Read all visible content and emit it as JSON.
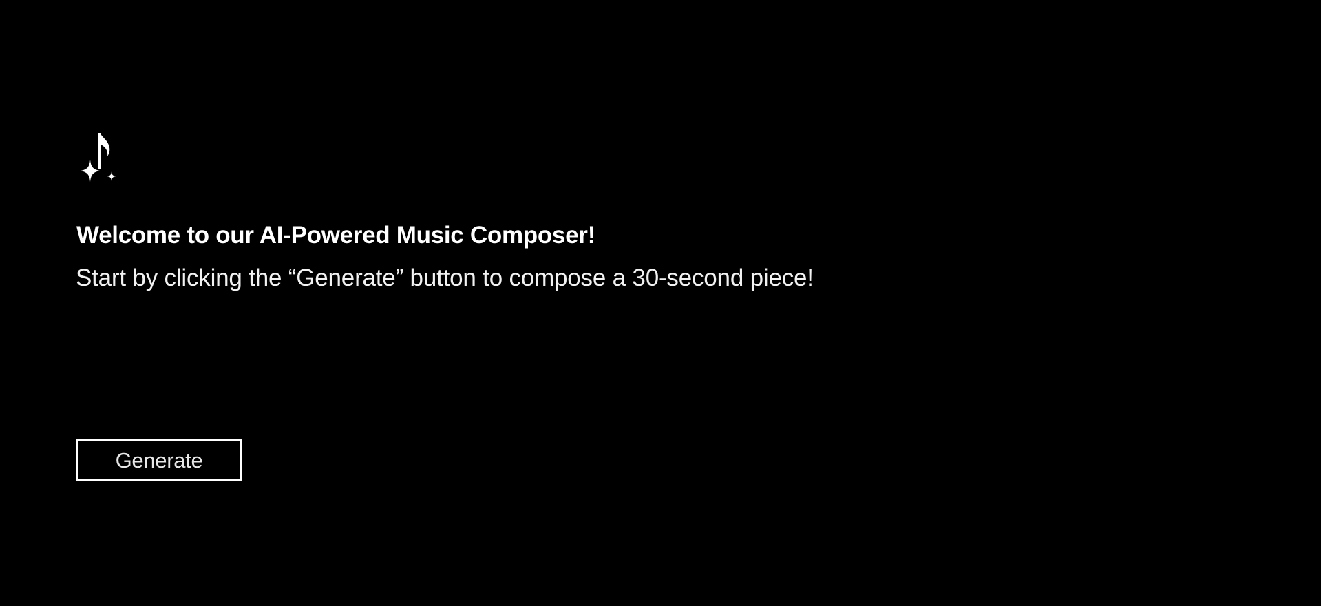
{
  "header": {
    "logo_icon": "music-note-sparkle-icon",
    "title": "Welcome to our AI-Powered Music Composer!",
    "subtitle": "Start by clicking the “Generate” button to compose a 30-second piece!"
  },
  "actions": {
    "generate_label": "Generate"
  },
  "colors": {
    "background": "#000000",
    "foreground": "#ffffff"
  }
}
